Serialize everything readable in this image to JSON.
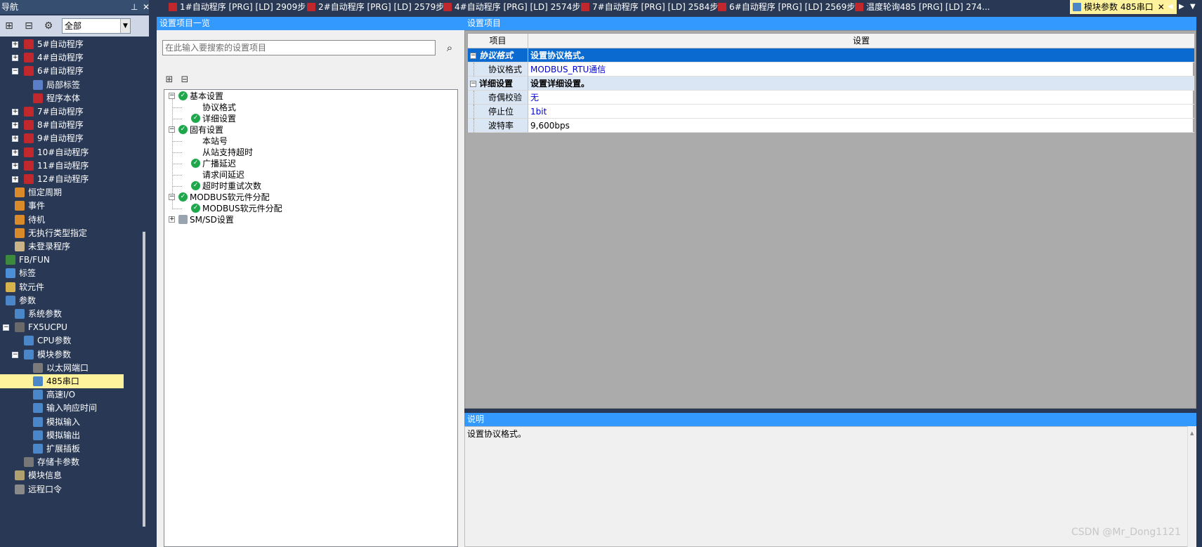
{
  "nav": {
    "title": "导航",
    "pin": "ᵽ",
    "close": "✕",
    "combo_value": "全部",
    "items": [
      {
        "label": "5#自动程序",
        "indent": 3,
        "exp": "+",
        "icon": "program-icon"
      },
      {
        "label": "4#自动程序",
        "indent": 3,
        "exp": "+",
        "icon": "program-icon"
      },
      {
        "label": "6#自动程序",
        "indent": 3,
        "exp": "-",
        "icon": "program-icon"
      },
      {
        "label": "局部标签",
        "indent": 4,
        "exp": "",
        "icon": "label-icon"
      },
      {
        "label": "程序本体",
        "indent": 4,
        "exp": "",
        "icon": "program-body-icon"
      },
      {
        "label": "7#自动程序",
        "indent": 3,
        "exp": "+",
        "icon": "program-icon"
      },
      {
        "label": "8#自动程序",
        "indent": 3,
        "exp": "+",
        "icon": "program-icon"
      },
      {
        "label": "9#自动程序",
        "indent": 3,
        "exp": "+",
        "icon": "program-icon"
      },
      {
        "label": "10#自动程序",
        "indent": 3,
        "exp": "+",
        "icon": "program-icon"
      },
      {
        "label": "11#自动程序",
        "indent": 3,
        "exp": "+",
        "icon": "program-icon"
      },
      {
        "label": "12#自动程序",
        "indent": 3,
        "exp": "+",
        "icon": "program-icon"
      },
      {
        "label": "恒定周期",
        "indent": 2,
        "exp": "",
        "icon": "task-icon"
      },
      {
        "label": "事件",
        "indent": 2,
        "exp": "",
        "icon": "task-icon"
      },
      {
        "label": "待机",
        "indent": 2,
        "exp": "",
        "icon": "task-icon"
      },
      {
        "label": "无执行类型指定",
        "indent": 2,
        "exp": "",
        "icon": "task-icon"
      },
      {
        "label": "未登录程序",
        "indent": 2,
        "exp": "",
        "icon": "unregistered-icon"
      },
      {
        "label": "FB/FUN",
        "indent": 1,
        "exp": "+",
        "icon": "fb-icon"
      },
      {
        "label": "标签",
        "indent": 1,
        "exp": "+",
        "icon": "tag-icon"
      },
      {
        "label": "软元件",
        "indent": 1,
        "exp": "+",
        "icon": "device-icon"
      },
      {
        "label": "参数",
        "indent": 1,
        "exp": "-",
        "icon": "param-icon"
      },
      {
        "label": "系统参数",
        "indent": 2,
        "exp": "",
        "icon": "param-icon"
      },
      {
        "label": "FX5UCPU",
        "indent": 2,
        "exp": "-",
        "icon": "cpu-icon"
      },
      {
        "label": "CPU参数",
        "indent": 3,
        "exp": "",
        "icon": "param-icon"
      },
      {
        "label": "模块参数",
        "indent": 3,
        "exp": "-",
        "icon": "param-icon"
      },
      {
        "label": "以太网端口",
        "indent": 4,
        "exp": "",
        "icon": "ethernet-icon"
      },
      {
        "label": "485串口",
        "indent": 4,
        "exp": "",
        "icon": "serial-icon",
        "selected": true
      },
      {
        "label": "高速I/O",
        "indent": 4,
        "exp": "",
        "icon": "param-icon"
      },
      {
        "label": "输入响应时间",
        "indent": 4,
        "exp": "",
        "icon": "param-icon"
      },
      {
        "label": "模拟输入",
        "indent": 4,
        "exp": "",
        "icon": "param-icon"
      },
      {
        "label": "模拟输出",
        "indent": 4,
        "exp": "",
        "icon": "param-icon"
      },
      {
        "label": "扩展插板",
        "indent": 4,
        "exp": "",
        "icon": "param-icon"
      },
      {
        "label": "存储卡参数",
        "indent": 3,
        "exp": "",
        "icon": "memory-card-icon"
      },
      {
        "label": "模块信息",
        "indent": 2,
        "exp": "",
        "icon": "module-info-icon"
      },
      {
        "label": "远程口令",
        "indent": 2,
        "exp": "",
        "icon": "remote-password-icon"
      }
    ]
  },
  "tabs": [
    {
      "label": "1#自动程序 [PRG] [LD] 2909步"
    },
    {
      "label": "2#自动程序 [PRG] [LD] 2579步"
    },
    {
      "label": "4#自动程序 [PRG] [LD] 2574步"
    },
    {
      "label": "7#自动程序 [PRG] [LD] 2584步"
    },
    {
      "label": "6#自动程序 [PRG] [LD] 2569步"
    },
    {
      "label": "温度轮询485 [PRG] [LD] 274..."
    },
    {
      "label": "模块参数 485串口",
      "active": true
    }
  ],
  "left_pane": {
    "title": "设置项目一览",
    "search_placeholder": "在此输入要搜索的设置项目",
    "tree": [
      {
        "label": "基本设置",
        "level": 0,
        "exp": "-",
        "check": true
      },
      {
        "label": "协议格式",
        "level": 1,
        "exp": "",
        "check": false
      },
      {
        "label": "详细设置",
        "level": 1,
        "exp": "",
        "check": true
      },
      {
        "label": "固有设置",
        "level": 0,
        "exp": "-",
        "check": true
      },
      {
        "label": "本站号",
        "level": 1,
        "exp": "",
        "check": false
      },
      {
        "label": "从站支持超时",
        "level": 1,
        "exp": "",
        "check": false
      },
      {
        "label": "广播延迟",
        "level": 1,
        "exp": "",
        "check": true
      },
      {
        "label": "请求间延迟",
        "level": 1,
        "exp": "",
        "check": false
      },
      {
        "label": "超时时重试次数",
        "level": 1,
        "exp": "",
        "check": true
      },
      {
        "label": "MODBUS软元件分配",
        "level": 0,
        "exp": "-",
        "check": true
      },
      {
        "label": "MODBUS软元件分配",
        "level": 1,
        "exp": "",
        "check": true
      },
      {
        "label": "SM/SD设置",
        "level": 0,
        "exp": "+",
        "check": false
      }
    ]
  },
  "right_pane": {
    "title": "设置项目",
    "col_item": "项目",
    "col_setting": "设置",
    "rows": [
      {
        "type": "group",
        "item": "协议格式",
        "value": "设置协议格式。",
        "highlight": true
      },
      {
        "type": "row",
        "item": "协议格式",
        "value": "MODBUS_RTU通信"
      },
      {
        "type": "group",
        "item": "详细设置",
        "value": "设置详细设置。"
      },
      {
        "type": "row",
        "item": "奇偶校验",
        "value": "无"
      },
      {
        "type": "row",
        "item": "停止位",
        "value": "1bit"
      },
      {
        "type": "row",
        "item": "波特率",
        "value": "9,600bps",
        "black": true
      }
    ]
  },
  "description": {
    "title": "说明",
    "text": "设置协议格式。"
  },
  "watermark": "CSDN @Mr_Dong1121",
  "colors": {
    "frame": "#293955",
    "title_bar": "#3399ff",
    "selected": "#fff29d",
    "highlight_row": "#0a6ad0",
    "check": "#1ea84b"
  }
}
